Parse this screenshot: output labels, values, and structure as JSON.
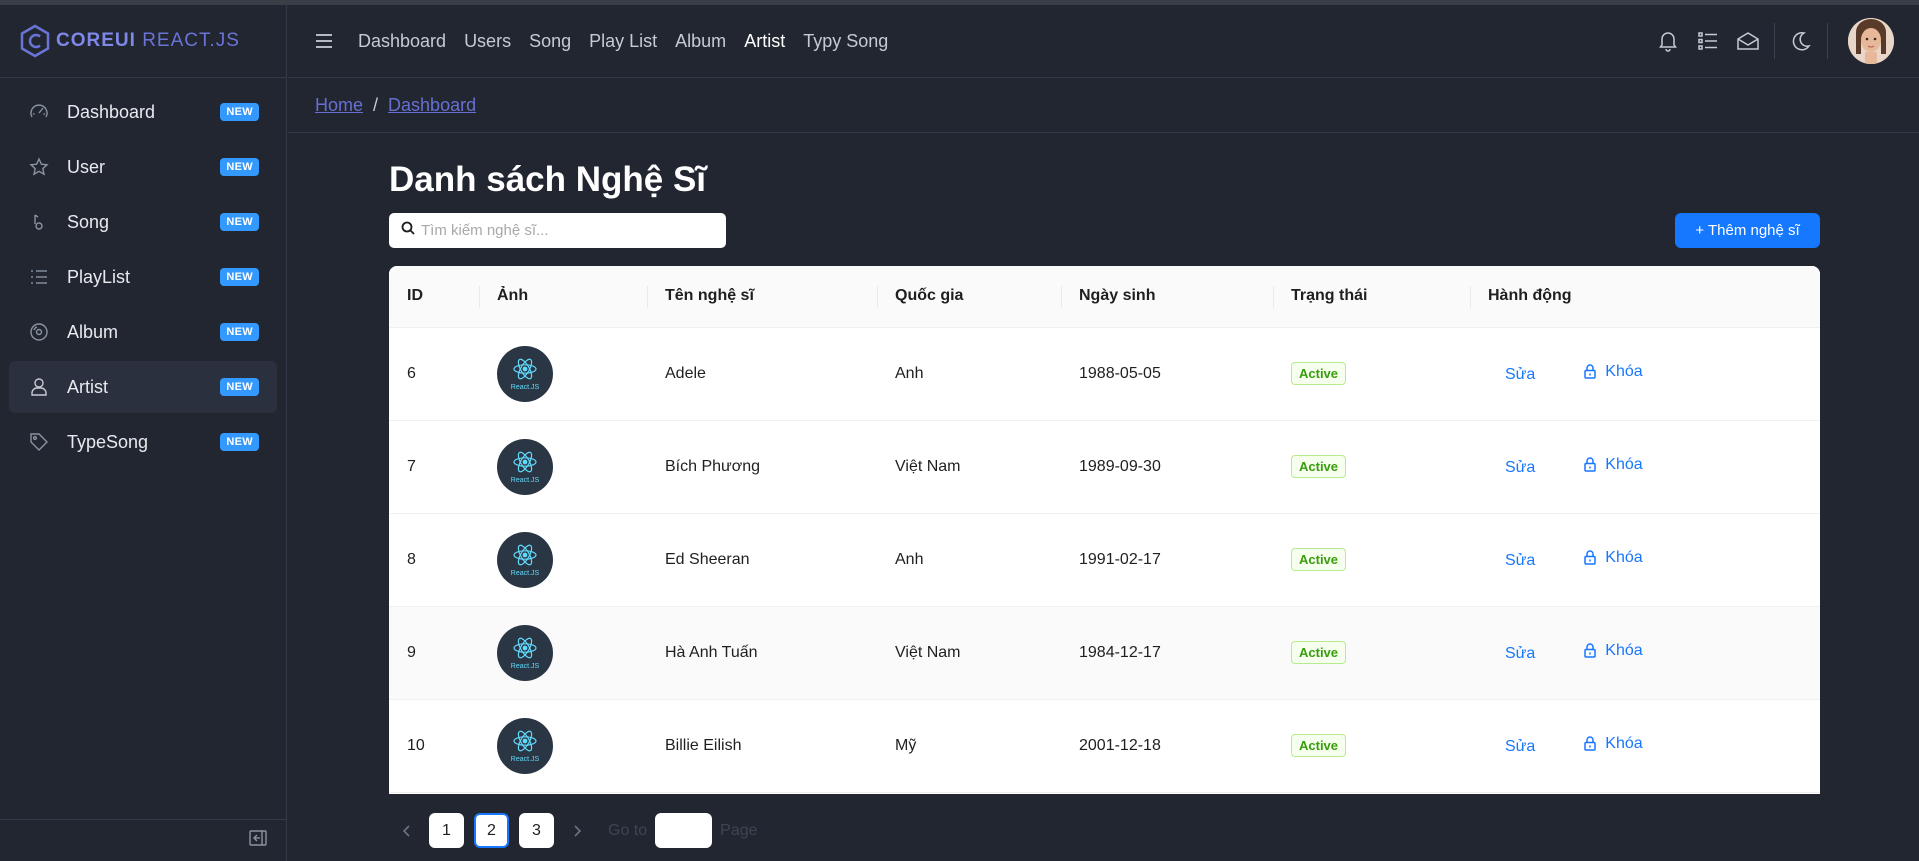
{
  "brand": {
    "name_bold": "COREUI",
    "name_light": "REACT.JS"
  },
  "sidebar": {
    "items": [
      {
        "label": "Dashboard",
        "badge": "NEW",
        "icon": "speedometer-icon"
      },
      {
        "label": "User",
        "badge": "NEW",
        "icon": "star-icon"
      },
      {
        "label": "Song",
        "badge": "NEW",
        "icon": "music-note-icon"
      },
      {
        "label": "PlayList",
        "badge": "NEW",
        "icon": "list-icon"
      },
      {
        "label": "Album",
        "badge": "NEW",
        "icon": "disc-icon"
      },
      {
        "label": "Artist",
        "badge": "NEW",
        "icon": "user-icon",
        "active": true
      },
      {
        "label": "TypeSong",
        "badge": "NEW",
        "icon": "tag-icon"
      }
    ]
  },
  "header": {
    "nav": [
      "Dashboard",
      "Users",
      "Song",
      "Play List",
      "Album",
      "Artist",
      "Typy Song"
    ],
    "active_nav": "Artist"
  },
  "breadcrumb": {
    "home": "Home",
    "separator": "/",
    "current": "Dashboard"
  },
  "page": {
    "title": "Danh sách Nghệ Sĩ",
    "search_placeholder": "Tìm kiếm nghệ sĩ...",
    "add_button": "+ Thêm nghệ sĩ"
  },
  "table": {
    "columns": [
      "ID",
      "Ảnh",
      "Tên nghệ sĩ",
      "Quốc gia",
      "Ngày sinh",
      "Trạng thái",
      "Hành động"
    ],
    "rows": [
      {
        "id": "6",
        "name": "Adele",
        "country": "Anh",
        "dob": "1988-05-05",
        "status": "Active",
        "edit": "Sửa",
        "lock": "Khóa",
        "thumb": "React.JS"
      },
      {
        "id": "7",
        "name": "Bích Phương",
        "country": "Việt Nam",
        "dob": "1989-09-30",
        "status": "Active",
        "edit": "Sửa",
        "lock": "Khóa",
        "thumb": "React.JS"
      },
      {
        "id": "8",
        "name": "Ed Sheeran",
        "country": "Anh",
        "dob": "1991-02-17",
        "status": "Active",
        "edit": "Sửa",
        "lock": "Khóa",
        "thumb": "React.JS"
      },
      {
        "id": "9",
        "name": "Hà Anh Tuấn",
        "country": "Việt Nam",
        "dob": "1984-12-17",
        "status": "Active",
        "edit": "Sửa",
        "lock": "Khóa",
        "thumb": "React.JS"
      },
      {
        "id": "10",
        "name": "Billie Eilish",
        "country": "Mỹ",
        "dob": "2001-12-18",
        "status": "Active",
        "edit": "Sửa",
        "lock": "Khóa",
        "thumb": "React.JS"
      }
    ]
  },
  "pagination": {
    "pages": [
      "1",
      "2",
      "3"
    ],
    "current": "2",
    "goto_label": "Go to",
    "page_label": "Page"
  },
  "colors": {
    "accent": "#1677ff",
    "badge": "#3399ff",
    "bg": "#212631",
    "brand": "#6a74d6"
  }
}
